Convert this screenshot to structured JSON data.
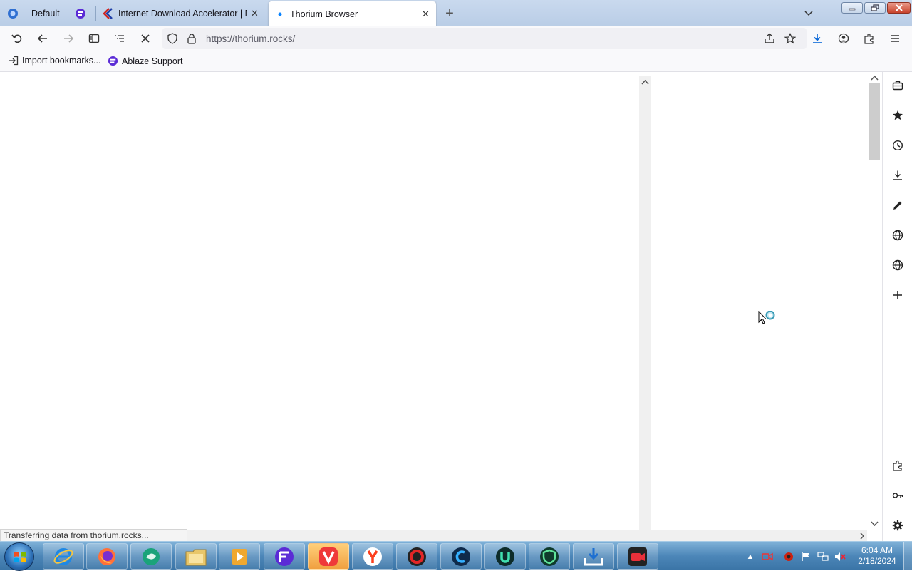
{
  "tabs": [
    {
      "label": "Default"
    },
    {
      "label": ""
    },
    {
      "label": "Internet Download Accelerator | D..."
    },
    {
      "label": "Thorium Browser"
    }
  ],
  "toolbar": {
    "url": "https://thorium.rocks/",
    "new_tab_symbol": "+"
  },
  "bookmarks": [
    {
      "label": "Import bookmarks..."
    },
    {
      "label": "Ablaze Support"
    }
  ],
  "status": {
    "text": "Transferring data from thorium.rocks..."
  },
  "clock": {
    "time": "6:04 AM",
    "date": "2/18/2024"
  },
  "colors": {
    "accent": "#0060df",
    "tabstrip": "#c1d3ea",
    "taskbar": "#4c86b8"
  }
}
